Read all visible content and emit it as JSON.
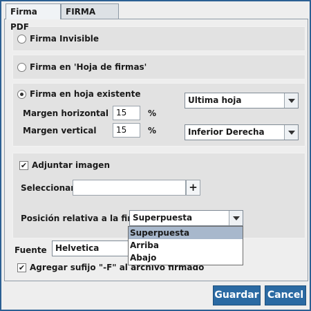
{
  "tabs": [
    {
      "label": "Firma PDF"
    },
    {
      "label": "FIRMA XML"
    }
  ],
  "firma_invisible": {
    "label": "Firma Invisible"
  },
  "firma_hoja_firmas": {
    "label": "Firma en 'Hoja de firmas'"
  },
  "firma_hoja_existente": {
    "label": "Firma en hoja existente",
    "page_select": {
      "value": "Ultima hoja"
    },
    "margen_horizontal": {
      "label": "Margen horizontal",
      "value": "15",
      "unit": "%"
    },
    "margen_vertical": {
      "label": "Margen vertical",
      "value": "15",
      "unit": "%"
    },
    "position_select": {
      "value": "Inferior Derecha"
    }
  },
  "adjuntar": {
    "label": "Adjuntar imagen",
    "seleccionar_label": "Seleccionar",
    "add_symbol": "+",
    "posicion_label": "Posición relativa a la firma",
    "posicion_select": {
      "value": "Superpuesta"
    },
    "posicion_options": [
      "Superpuesta",
      "Arriba",
      "Abajo"
    ]
  },
  "fuente": {
    "label": "Fuente",
    "value": "Helvetica"
  },
  "sufijo": {
    "label": "Agregar sufijo \"-F\" al archivo firmado"
  },
  "buttons": {
    "guardar": "Guardar",
    "cancelar": "Cancel"
  }
}
